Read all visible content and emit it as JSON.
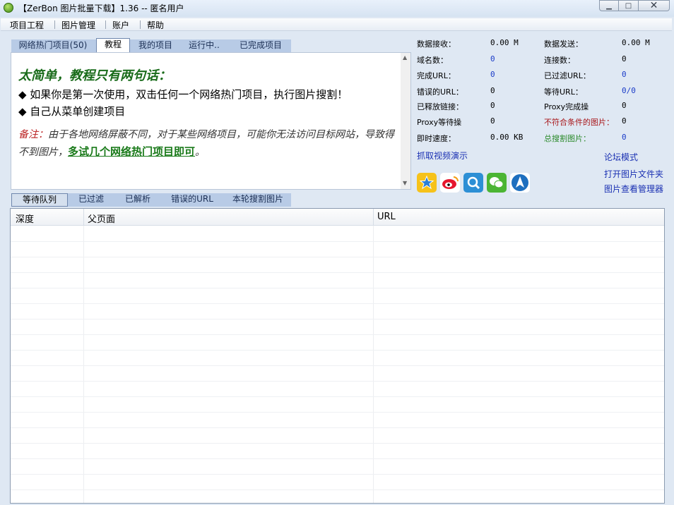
{
  "window": {
    "title": "【ZerBon 图片批量下载】1.36 -- 匿名用户",
    "icons": [
      "app-icon",
      "minimize-icon",
      "maximize-icon",
      "close-icon"
    ]
  },
  "menu": [
    "项目工程",
    "图片管理",
    "账户",
    "帮助"
  ],
  "top_tabs": [
    {
      "label": "网络热门项目(50)",
      "active": false
    },
    {
      "label": "教程",
      "active": true
    },
    {
      "label": "我的项目",
      "active": false
    },
    {
      "label": "运行中..",
      "active": false
    },
    {
      "label": "已完成项目",
      "active": false
    }
  ],
  "tutorial": {
    "heading": "太简单，教程只有两句话：",
    "line1": "◆ 如果你是第一次使用，双击任何一个网络热门项目，执行图片搜割！",
    "line2": "◆ 自己从菜单创建项目",
    "note_label": "备注：",
    "note_text": "由于各地网络屏蔽不同，对于某些网络项目，可能你无法访问目标网站，导致得不到图片，",
    "note_link": "多试几个网络热门项目即可",
    "note_end": "。"
  },
  "stats": {
    "data_received": {
      "label": "数据接收：",
      "value": "0.00 M"
    },
    "domain_count": {
      "label": "域名数：",
      "value": "0"
    },
    "completed_url": {
      "label": "完成URL：",
      "value": "0"
    },
    "error_url": {
      "label": "错误的URL：",
      "value": "0"
    },
    "released_links": {
      "label": "已释放链接：",
      "value": "0"
    },
    "proxy_waiting": {
      "label": "Proxy等待操",
      "value": "0"
    },
    "instant_speed": {
      "label": "即时速度：",
      "value": "0.00 KB"
    },
    "data_sent": {
      "label": "数据发送：",
      "value": "0.00 M"
    },
    "connections": {
      "label": "连接数：",
      "value": "0"
    },
    "filtered_url": {
      "label": "已过滤URL：",
      "value": "0"
    },
    "waiting_url": {
      "label": "等待URL：",
      "value": "0/0"
    },
    "proxy_done": {
      "label": "Proxy完成操",
      "value": "0"
    },
    "rejected_images": {
      "label": "不符合条件的图片：",
      "value": "0"
    },
    "total_images": {
      "label": "总搜割图片：",
      "value": "0"
    }
  },
  "links": {
    "video_demo": "抓取视频演示",
    "forum_mode": "论坛模式",
    "open_folder": "打开图片文件夹",
    "image_manager": "图片查看管理器"
  },
  "social_icons": [
    "qzone-icon",
    "weibo-icon",
    "qq-icon",
    "wechat-icon",
    "airplane-icon"
  ],
  "bottom_tabs": [
    {
      "label": "等待队列",
      "active": true
    },
    {
      "label": "已过滤",
      "active": false
    },
    {
      "label": "已解析",
      "active": false
    },
    {
      "label": "错误的URL",
      "active": false
    },
    {
      "label": "本轮搜割图片",
      "active": false
    }
  ],
  "table": {
    "columns": [
      "深度",
      "父页面",
      "URL"
    ],
    "rows": []
  },
  "colors": {
    "link_blue": "#1b31b3",
    "note_red": "#a8161a",
    "total_green": "#2b8a2b",
    "heading_green": "#196b1a"
  }
}
